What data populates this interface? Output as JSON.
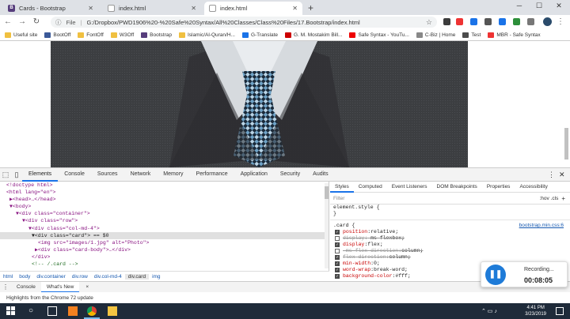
{
  "tabs": [
    {
      "title": "Cards - Bootstrap",
      "icon": "bootstrap-icon",
      "active": false
    },
    {
      "title": "index.html",
      "icon": "page-icon",
      "active": false
    },
    {
      "title": "index.html",
      "icon": "page-icon",
      "active": true
    }
  ],
  "address": {
    "label": "File",
    "url": "G:/Dropbox/PWD1906%20-%20Safe%20Syntax/All%20Classes/Class%20Files/17.Bootstrap/index.html"
  },
  "bookmarks": [
    "Useful site",
    "BootOff",
    "FontOff",
    "W3Off",
    "Bootstrap",
    "Islamic/Al-Quran/H...",
    "G-Translate",
    "G. M. Mostakim Bill...",
    "Safe Syntax - YouTu...",
    "C-Biz | Home",
    "Test",
    "MBR - Safe Syntax"
  ],
  "bookmark_colors": [
    "#f0c040",
    "#3b5998",
    "#f0c040",
    "#f0c040",
    "#563d7c",
    "#f0c040",
    "#1a73e8",
    "#c00",
    "#e00",
    "#888",
    "#4c4c4c",
    "#e33"
  ],
  "devtools": {
    "tabs": [
      "Elements",
      "Console",
      "Sources",
      "Network",
      "Memory",
      "Performance",
      "Application",
      "Security",
      "Audits"
    ],
    "active_tab": "Elements",
    "dom_lines": [
      "<!doctype html>",
      "<html lang=\"en\">",
      "▶<head>…</head>",
      "▼<body>",
      "▼<div class=\"container\">",
      "▼<div class=\"row\">",
      "▼<div class=\"col-md-4\">",
      "▼<div class=\"card\"> == $0",
      "<img src=\"images/1.jpg\" alt=\"Photo\">",
      "▶<div class=\"card-body\">…</div>",
      "</div>",
      "<!-- /.card -->"
    ],
    "breadcrumbs": [
      "html",
      "body",
      "div.container",
      "div.row",
      "div.col-md-4",
      "div.card",
      "img"
    ],
    "style_tabs": [
      "Styles",
      "Computed",
      "Event Listeners",
      "DOM Breakpoints",
      "Properties",
      "Accessibility"
    ],
    "filter_placeholder": "Filter",
    "hov_cls": ":hov .cls",
    "plus": "+",
    "element_style": "element.style {",
    "close_brace": "}",
    "card_selector": ".card {",
    "card_source": "bootstrap.min.css:6",
    "declarations": [
      {
        "prop": "position",
        "value": "relative;",
        "checked": true,
        "struck": false
      },
      {
        "prop": "display",
        "value": "-ms-flexbox;",
        "checked": false,
        "struck": true
      },
      {
        "prop": "display",
        "value": "flex;",
        "checked": true,
        "struck": false
      },
      {
        "prop": "-ms-flex-direction",
        "value": "column;",
        "checked": false,
        "struck": true
      },
      {
        "prop": "flex-direction",
        "value": "column;",
        "checked": true,
        "struck": true
      },
      {
        "prop": "min-width",
        "value": "0;",
        "checked": true,
        "struck": false
      },
      {
        "prop": "word-wrap",
        "value": "break-word;",
        "checked": true,
        "struck": false
      },
      {
        "prop": "background-color",
        "value": "#fff;",
        "checked": true,
        "struck": false
      }
    ],
    "drawer_tabs": [
      "Console",
      "What's New"
    ],
    "drawer_close": "×",
    "drawer_text": "Highlights from the Chrome 72 update"
  },
  "recording": {
    "label": "Recording...",
    "time": "00:08:05"
  },
  "clock": {
    "time": "4:41 PM",
    "date": "3/23/2019"
  }
}
